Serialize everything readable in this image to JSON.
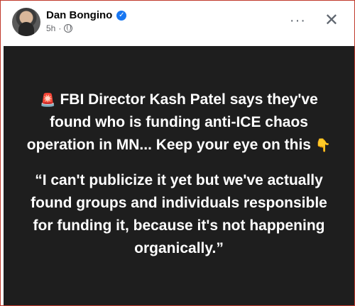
{
  "post": {
    "author": "Dan Bongino",
    "verified_mark": "✓",
    "time": "5h",
    "separator": "·",
    "more_label": "···",
    "close_label": "✕",
    "emoji_siren": "🚨",
    "headline": "FBI Director Kash Patel says they've found who is funding anti-ICE chaos operation in MN... Keep your eye on this",
    "emoji_hand": "👇",
    "quote": "“I can't publicize it yet but we've actually found groups and individuals responsible for funding it, because it's not happening organically.”"
  },
  "colors": {
    "card_bg": "#1e1e1e",
    "text": "#ffffff",
    "verified": "#1877f2",
    "meta": "#65676b"
  },
  "icons": [
    "verified-icon",
    "globe-icon",
    "more-options-icon",
    "close-icon",
    "siren-emoji",
    "pointing-down-emoji"
  ]
}
